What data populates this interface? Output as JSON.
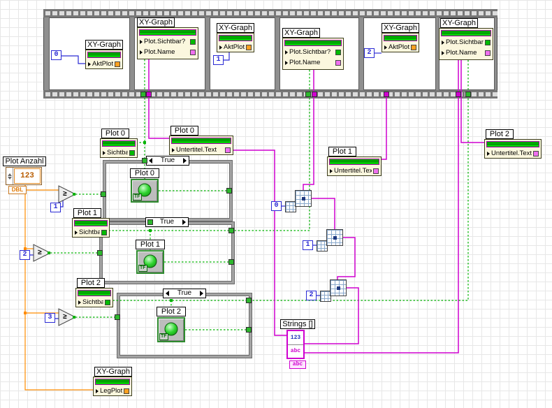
{
  "seq": {
    "frames": [
      {
        "label": "XY-Graph",
        "rows": [
          "AktPlot"
        ],
        "const": "0"
      },
      {
        "label": "XY-Graph",
        "rows": [
          "Plot.Sichtbar?",
          "Plot.Name"
        ]
      },
      {
        "label": "XY-Graph",
        "rows": [
          "AktPlot"
        ],
        "const": "1"
      },
      {
        "label": "XY-Graph",
        "rows": [
          "Plot.Sichtbar?",
          "Plot.Name"
        ]
      },
      {
        "label": "XY-Graph",
        "rows": [
          "AktPlot"
        ],
        "const": "2"
      },
      {
        "label": "XY-Graph",
        "rows": [
          "Plot.Sichtbar?",
          "Plot.Name"
        ]
      }
    ]
  },
  "props": {
    "p0vis": {
      "label": "Plot 0",
      "prop": "Sichtbar"
    },
    "p0sub": {
      "label": "Plot 0",
      "prop": "Untertitel.Text"
    },
    "p1vis": {
      "label": "Plot 1",
      "prop": "Sichtbar"
    },
    "p1sub": {
      "label": "Plot 1",
      "prop": "Untertitel.Text"
    },
    "p2vis": {
      "label": "Plot 2",
      "prop": "Sichtbar"
    },
    "p2sub": {
      "label": "Plot 2",
      "prop": "Untertitel.Text"
    },
    "leg": {
      "label": "XY-Graph",
      "prop": "LegPlots"
    },
    "strings": {
      "label": "Strings []",
      "num": "123",
      "str": "abc"
    }
  },
  "control": {
    "label": "Plot Anzahl",
    "digits": "123",
    "type": "DBL"
  },
  "leds": [
    {
      "label": "Plot 0"
    },
    {
      "label": "Plot 1"
    },
    {
      "label": "Plot 2"
    }
  ],
  "led_tag": "TF",
  "cases": [
    {
      "sel": "True"
    },
    {
      "sel": "True"
    },
    {
      "sel": "True"
    }
  ],
  "cmp": {
    "sym": "≥",
    "consts": [
      "1",
      "2",
      "3"
    ]
  },
  "idx": [
    "0",
    "1",
    "2"
  ],
  "colors": {
    "wire_numeric": "#ff8c00",
    "wire_int": "#2a2ad4",
    "wire_bool": "#00b300",
    "wire_string": "#cf00cf",
    "node_bg": "#fbf7de",
    "accent_green": "#00c000"
  }
}
